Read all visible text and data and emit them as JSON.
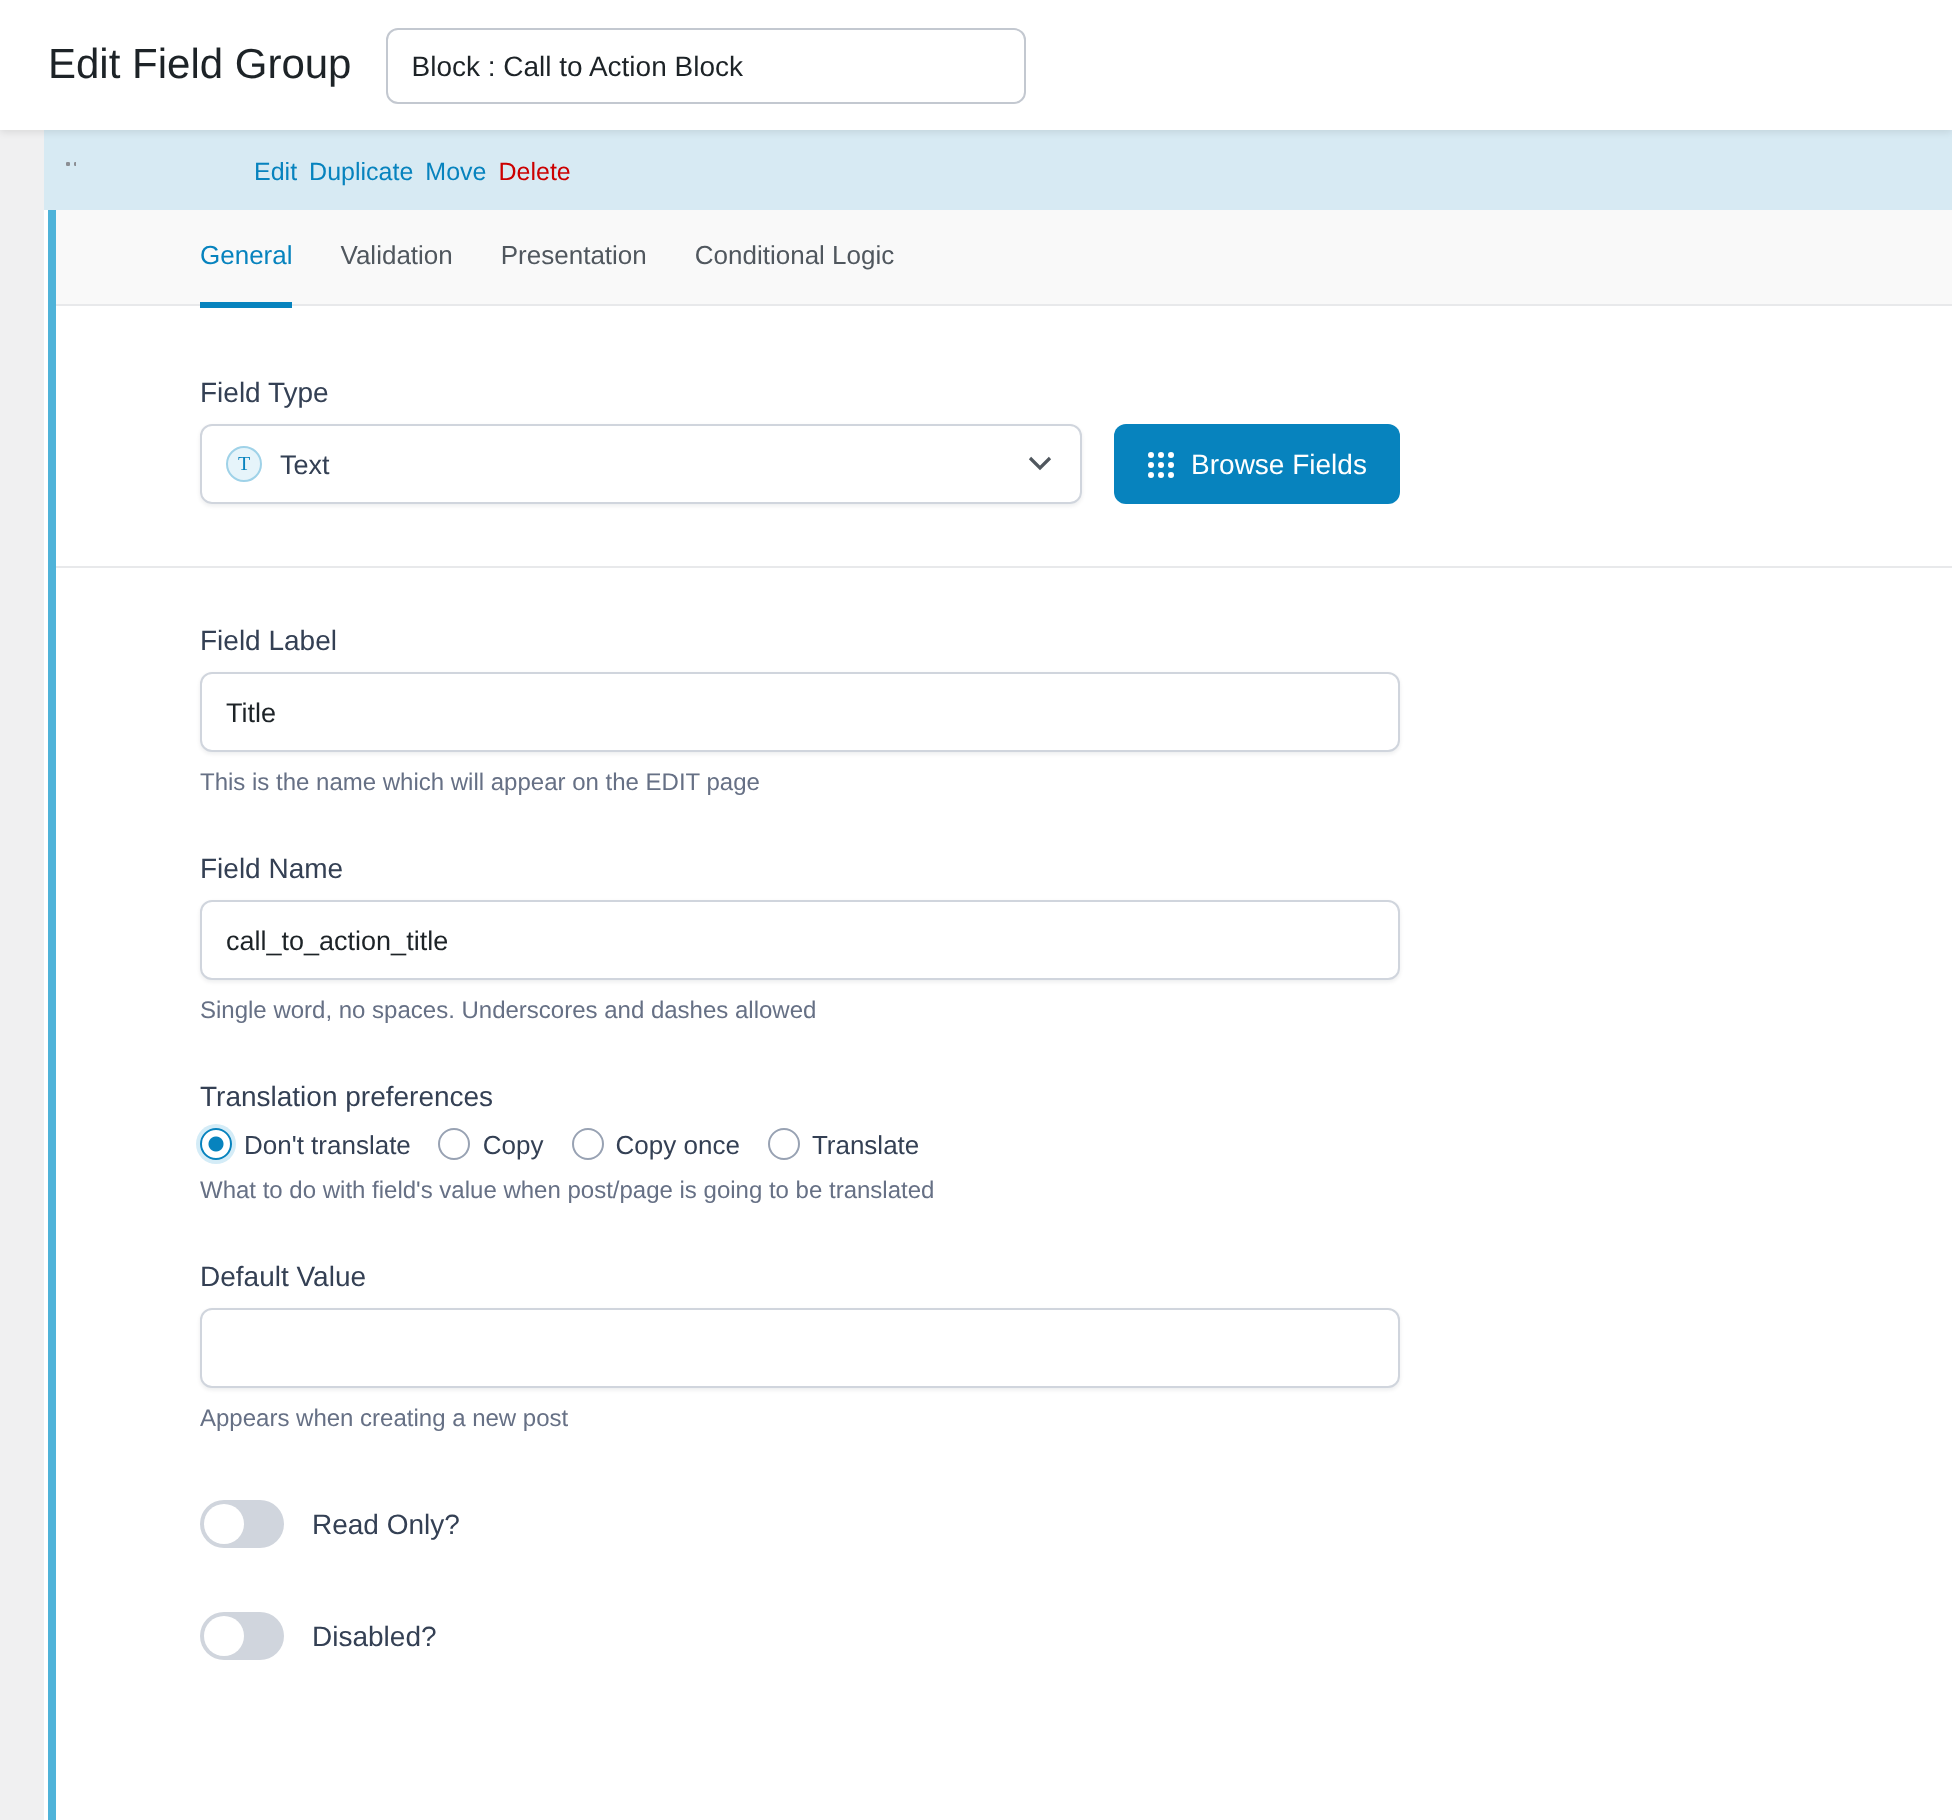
{
  "header": {
    "title": "Edit Field Group",
    "group_title_value": "Block : Call to Action Block"
  },
  "field_row": {
    "actions": [
      {
        "label": "Edit",
        "kind": "normal"
      },
      {
        "label": "Duplicate",
        "kind": "normal"
      },
      {
        "label": "Move",
        "kind": "normal"
      },
      {
        "label": "Delete",
        "kind": "danger"
      }
    ]
  },
  "tabs": [
    {
      "label": "General",
      "selected": true
    },
    {
      "label": "Validation",
      "selected": false
    },
    {
      "label": "Presentation",
      "selected": false
    },
    {
      "label": "Conditional Logic",
      "selected": false
    }
  ],
  "field_type": {
    "label": "Field Type",
    "value": "Text",
    "icon_letter": "T",
    "browse_button": "Browse Fields"
  },
  "field_label": {
    "label": "Field Label",
    "value": "Title",
    "hint": "This is the name which will appear on the EDIT page"
  },
  "field_name": {
    "label": "Field Name",
    "value": "call_to_action_title",
    "hint": "Single word, no spaces. Underscores and dashes allowed"
  },
  "translation": {
    "label": "Translation preferences",
    "options": [
      {
        "label": "Don't translate",
        "selected": true
      },
      {
        "label": "Copy",
        "selected": false
      },
      {
        "label": "Copy once",
        "selected": false
      },
      {
        "label": "Translate",
        "selected": false
      }
    ],
    "hint": "What to do with field's value when post/page is going to be translated"
  },
  "default_value": {
    "label": "Default Value",
    "hint": "Appears when creating a new post"
  },
  "toggles": [
    {
      "label": "Read Only?",
      "on": false
    },
    {
      "label": "Disabled?",
      "on": false
    }
  ]
}
